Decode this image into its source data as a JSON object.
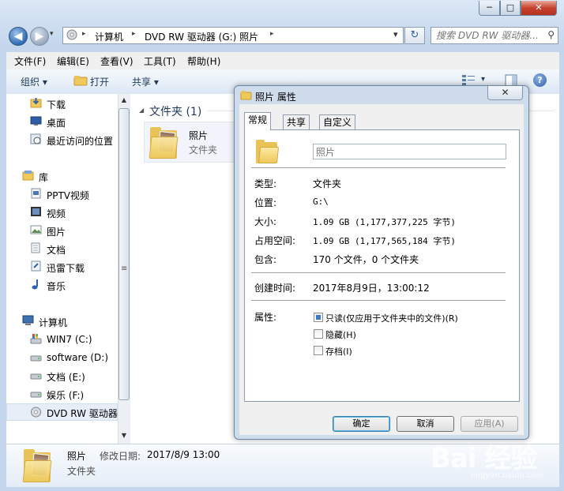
{
  "window": {
    "min_label": "─",
    "max_label": "□",
    "close_label": "✕"
  },
  "nav": {
    "back": "◀",
    "forward": "▶",
    "drop": "▾"
  },
  "address": {
    "parts": [
      "计算机",
      "DVD RW 驱动器 (G:) 照片"
    ],
    "sep": "▸",
    "drop": "▾",
    "refresh": "↻"
  },
  "search": {
    "placeholder": "搜索 DVD RW 驱动器...",
    "icon": "⚲"
  },
  "menubar": [
    "文件(F)",
    "编辑(E)",
    "查看(V)",
    "工具(T)",
    "帮助(H)"
  ],
  "commandbar": {
    "organize": "组织 ▾",
    "open": "打开",
    "share": "共享 ▾",
    "views": "▾",
    "help": "?"
  },
  "sidebar": {
    "items": [
      {
        "label": "下载",
        "icon": "download-icon"
      },
      {
        "label": "桌面",
        "icon": "desktop-icon"
      },
      {
        "label": "最近访问的位置",
        "icon": "recent-places-icon"
      },
      {
        "label": "库",
        "icon": "library-icon"
      },
      {
        "label": "PPTV视频",
        "icon": "video-library-icon"
      },
      {
        "label": "视频",
        "icon": "video-icon"
      },
      {
        "label": "图片",
        "icon": "pictures-icon"
      },
      {
        "label": "文档",
        "icon": "documents-icon"
      },
      {
        "label": "迅雷下载",
        "icon": "thunder-download-icon"
      },
      {
        "label": "音乐",
        "icon": "music-icon"
      },
      {
        "label": "计算机",
        "icon": "computer-icon"
      },
      {
        "label": "WIN7 (C:)",
        "icon": "system-drive-icon"
      },
      {
        "label": "software (D:)",
        "icon": "drive-icon"
      },
      {
        "label": "文档 (E:)",
        "icon": "drive-icon"
      },
      {
        "label": "娱乐 (F:)",
        "icon": "drive-icon"
      },
      {
        "label": "DVD RW 驱动器",
        "icon": "dvd-drive-icon"
      }
    ],
    "scroll_mid": "≡",
    "scroll_up": "▲",
    "scroll_down": "▼"
  },
  "content": {
    "group_header": "文件夹 (1)",
    "group_arrow": "◢",
    "tile": {
      "name": "照片",
      "type": "文件夹"
    }
  },
  "details": {
    "name": "照片",
    "modified_label": "修改日期:",
    "modified_value": "2017/8/9 13:00",
    "type": "文件夹"
  },
  "dialog": {
    "title": "照片 属性",
    "close": "✕",
    "tabs": [
      "常规",
      "共享",
      "自定义"
    ],
    "name_value": "照片",
    "props": [
      {
        "label": "类型:",
        "value": "文件夹"
      },
      {
        "label": "位置:",
        "value": "G:\\"
      },
      {
        "label": "大小:",
        "value": "1.09 GB (1,177,377,225 字节)"
      },
      {
        "label": "占用空间:",
        "value": "1.09 GB (1,177,565,184 字节)"
      },
      {
        "label": "包含:",
        "value": "170 个文件，0 个文件夹"
      }
    ],
    "created_label": "创建时间:",
    "created_value": "2017年8月9日，13:00:12",
    "attributes_label": "属性:",
    "attributes": [
      {
        "label": "只读(仅应用于文件夹中的文件)(R)",
        "state": "mixed"
      },
      {
        "label": "隐藏(H)",
        "state": "off"
      },
      {
        "label": "存档(I)",
        "state": "off"
      }
    ],
    "buttons": {
      "ok": "确定",
      "cancel": "取消",
      "apply": "应用(A)"
    }
  },
  "watermark": {
    "text": "Bai 经验",
    "sub": "jingyan.baidu.com"
  },
  "colors": {
    "accent": "#3d7ac4",
    "folder": "#e9c258",
    "chrome": "#c3d6ec"
  }
}
